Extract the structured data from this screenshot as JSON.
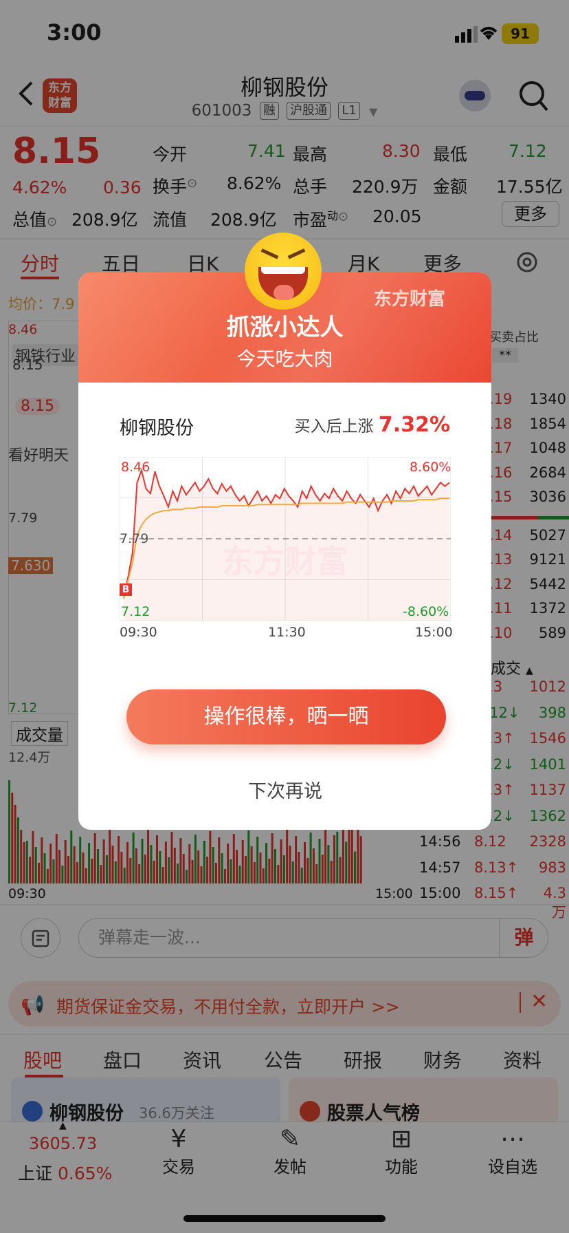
{
  "status": {
    "time": "3:00",
    "battery": "91"
  },
  "header": {
    "logo": "东方财富",
    "title": "柳钢股份",
    "code": "601003",
    "tags": [
      "融",
      "沪股通",
      "L1"
    ]
  },
  "quote": {
    "price": "8.15",
    "change_pct": "4.62%",
    "change": "0.36",
    "today_open_label": "今开",
    "today_open": "7.41",
    "high_label": "最高",
    "high": "8.30",
    "low_label": "最低",
    "low": "7.12",
    "turnover_label": "换手",
    "turnover": "8.62%",
    "volume_label": "总手",
    "volume": "220.9万",
    "amount_label": "金额",
    "amount": "17.55亿",
    "mktcap_label": "总值",
    "mktcap": "208.9亿",
    "float_label": "流值",
    "float": "208.9亿",
    "pe_label": "市盈",
    "pe_sup": "动",
    "pe": "20.05",
    "more": "更多"
  },
  "chart_tabs": [
    "分时",
    "五日",
    "日K",
    "月K",
    "更多"
  ],
  "chart_side": {
    "avg_label": "均价：7.9",
    "top_price": "8.46",
    "sector": "钢铁行业",
    "sector_val": "8.15",
    "mark": "8.15",
    "hint": "看好明天",
    "ref": "7.79",
    "cur": "7.630",
    "bottom": "7.12",
    "vol_tab": "成交量",
    "vol_max": "12.4万",
    "time_start": "09:30",
    "time_end": "15:00",
    "ratio": "买卖占比",
    "ratio_val": "**"
  },
  "order_book": [
    {
      "p": ".19",
      "v": "1340"
    },
    {
      "p": ".18",
      "v": "1854"
    },
    {
      "p": ".17",
      "v": "1048"
    },
    {
      "p": ".16",
      "v": "2684"
    },
    {
      "p": ".15",
      "v": "3036"
    },
    {
      "p": ".14",
      "v": "5027"
    },
    {
      "p": ".13",
      "v": "9121"
    },
    {
      "p": ".12",
      "v": "5442"
    },
    {
      "p": ".11",
      "v": "1372"
    },
    {
      "p": ".10",
      "v": "589"
    }
  ],
  "trades_label": "成交",
  "trades": [
    {
      "t": "",
      "p": "13",
      "v": "1012"
    },
    {
      "t": "",
      "p": "12↓",
      "v": "398"
    },
    {
      "t": "",
      "p": "13↑",
      "v": "1546"
    },
    {
      "t": "",
      "p": "12↓",
      "v": "1401"
    },
    {
      "t": "",
      "p": "13↑",
      "v": "1137"
    },
    {
      "t": "",
      "p": "12↓",
      "v": "1362"
    },
    {
      "t": "14:56",
      "p": "8.12",
      "v": "2328"
    },
    {
      "t": "14:57",
      "p": "8.13↑",
      "v": "983"
    },
    {
      "t": "15:00",
      "p": "8.15↑",
      "v": "4.3万"
    }
  ],
  "danmaku": {
    "placeholder": "弹幕走一波...",
    "send": "弹"
  },
  "ad": {
    "text": "期货保证金交易，不用付全款，立即开户 >>"
  },
  "section_tabs": [
    "股吧",
    "盘口",
    "资讯",
    "公告",
    "研报",
    "财务",
    "资料"
  ],
  "cards": [
    {
      "title": "柳钢股份",
      "sub": "36.6万关注"
    },
    {
      "title": "股票人气榜",
      "sub": ""
    }
  ],
  "bottom_nav": {
    "index_value": "3605.73",
    "index_name": "上证",
    "index_pct": "0.65%",
    "items": [
      "交易",
      "发帖",
      "功能",
      "设自选"
    ]
  },
  "modal": {
    "brand": "东方财富",
    "title": "抓涨小达人",
    "subtitle": "今天吃大肉",
    "stock": "柳钢股份",
    "gain_label": "买入后上涨",
    "gain": "7.32%",
    "watermark": "东方财富",
    "share_button": "操作很棒，晒一晒",
    "later_button": "下次再说"
  },
  "chart_data": {
    "type": "line",
    "y_max_label": "8.46",
    "y_min_label": "7.12",
    "pct_max_label": "8.60%",
    "pct_min_label": "-8.60%",
    "ref_label": "7.79",
    "buy_marker": "B",
    "x_ticks": [
      "09:30",
      "11:30",
      "15:00"
    ],
    "ylim": [
      7.12,
      8.46
    ],
    "series": [
      {
        "values": [
          7.3,
          7.48,
          7.68,
          8.25,
          8.35,
          8.2,
          8.16,
          8.34,
          8.22,
          8.14,
          8.05,
          8.18,
          8.1,
          8.22,
          8.15,
          8.2,
          8.25,
          8.18,
          8.22,
          8.28,
          8.2,
          8.16,
          8.24,
          8.18,
          8.22,
          8.15,
          8.1,
          8.14,
          8.06,
          8.12,
          8.18,
          8.1,
          8.14,
          8.08,
          8.15,
          8.12,
          8.2,
          8.14,
          8.1,
          8.05,
          8.18,
          8.12,
          8.22,
          8.15,
          8.1,
          8.16,
          8.12,
          8.2,
          8.14,
          8.1,
          8.18,
          8.12,
          8.08,
          8.15,
          8.1,
          8.05,
          8.12,
          8.02,
          8.1,
          8.15,
          8.08,
          8.18,
          8.12,
          8.2,
          8.16,
          8.22,
          8.14,
          8.18,
          8.22,
          8.15,
          8.2,
          8.25,
          8.22,
          8.25
        ]
      },
      {
        "values": [
          7.3,
          7.45,
          7.6,
          7.82,
          7.9,
          7.95,
          7.98,
          8.0,
          8.01,
          8.02,
          8.02,
          8.03,
          8.03,
          8.03,
          8.04,
          8.04,
          8.04,
          8.05,
          8.05,
          8.05,
          8.05,
          8.05,
          8.06,
          8.06,
          8.06,
          8.06,
          8.06,
          8.06,
          8.06,
          8.06,
          8.07,
          8.07,
          8.07,
          8.07,
          8.07,
          8.07,
          8.07,
          8.07,
          8.07,
          8.07,
          8.08,
          8.08,
          8.08,
          8.08,
          8.08,
          8.08,
          8.08,
          8.08,
          8.08,
          8.08,
          8.09,
          8.09,
          8.09,
          8.09,
          8.09,
          8.09,
          8.09,
          8.09,
          8.09,
          8.09,
          8.1,
          8.1,
          8.1,
          8.1,
          8.1,
          8.1,
          8.11,
          8.11,
          8.11,
          8.11,
          8.11,
          8.12,
          8.12,
          8.12
        ]
      }
    ]
  }
}
